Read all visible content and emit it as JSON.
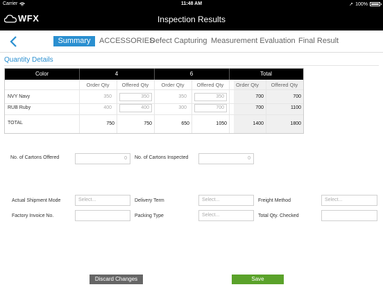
{
  "status": {
    "carrier": "Carrier",
    "time": "11:48 AM",
    "battery": "100%"
  },
  "header": {
    "logo": "WFX",
    "title": "Inspection Results"
  },
  "tabs": [
    "Summary",
    "ACCESSORIES",
    "Defect Capturing",
    "Measurement Evaluation",
    "Final Result"
  ],
  "section": {
    "title": "Quantity Details"
  },
  "grid": {
    "columns": {
      "color": "Color",
      "size1": "4",
      "size2": "6",
      "total": "Total"
    },
    "subheaders": [
      "Order Qty",
      "Offered Qty",
      "Order Qty",
      "Offered Qty",
      "Order Qty",
      "Offered Qty"
    ],
    "rows": [
      {
        "label": "NVY Navy",
        "values": [
          "350",
          "350",
          "350",
          "350",
          "700",
          "700"
        ]
      },
      {
        "label": "RUB Ruby",
        "values": [
          "400",
          "400",
          "300",
          "700",
          "700",
          "1100"
        ]
      },
      {
        "label": "TOTAL",
        "values": [
          "750",
          "750",
          "650",
          "1050",
          "1400",
          "1800"
        ]
      }
    ]
  },
  "cartons": {
    "offered_label": "No. of Cartons Offered",
    "offered_value": "0",
    "inspected_label": "No. of Cartons Inspected",
    "inspected_value": "0"
  },
  "shipment": {
    "mode_label": "Actual Shipment Mode",
    "mode_placeholder": "Select...",
    "delivery_label": "Delivery Term",
    "delivery_placeholder": "Select...",
    "freight_label": "Freight Method",
    "freight_placeholder": "Select...",
    "invoice_label": "Factory Invoice No.",
    "packing_label": "Packing Type",
    "packing_placeholder": "Select...",
    "total_qty_label": "Total Qty. Checked"
  },
  "footer": {
    "discard": "Discard Changes",
    "save": "Save"
  },
  "colors": {
    "accent": "#2a8fd0",
    "save": "#5aa22a",
    "discard": "#666666",
    "header": "#000000"
  }
}
